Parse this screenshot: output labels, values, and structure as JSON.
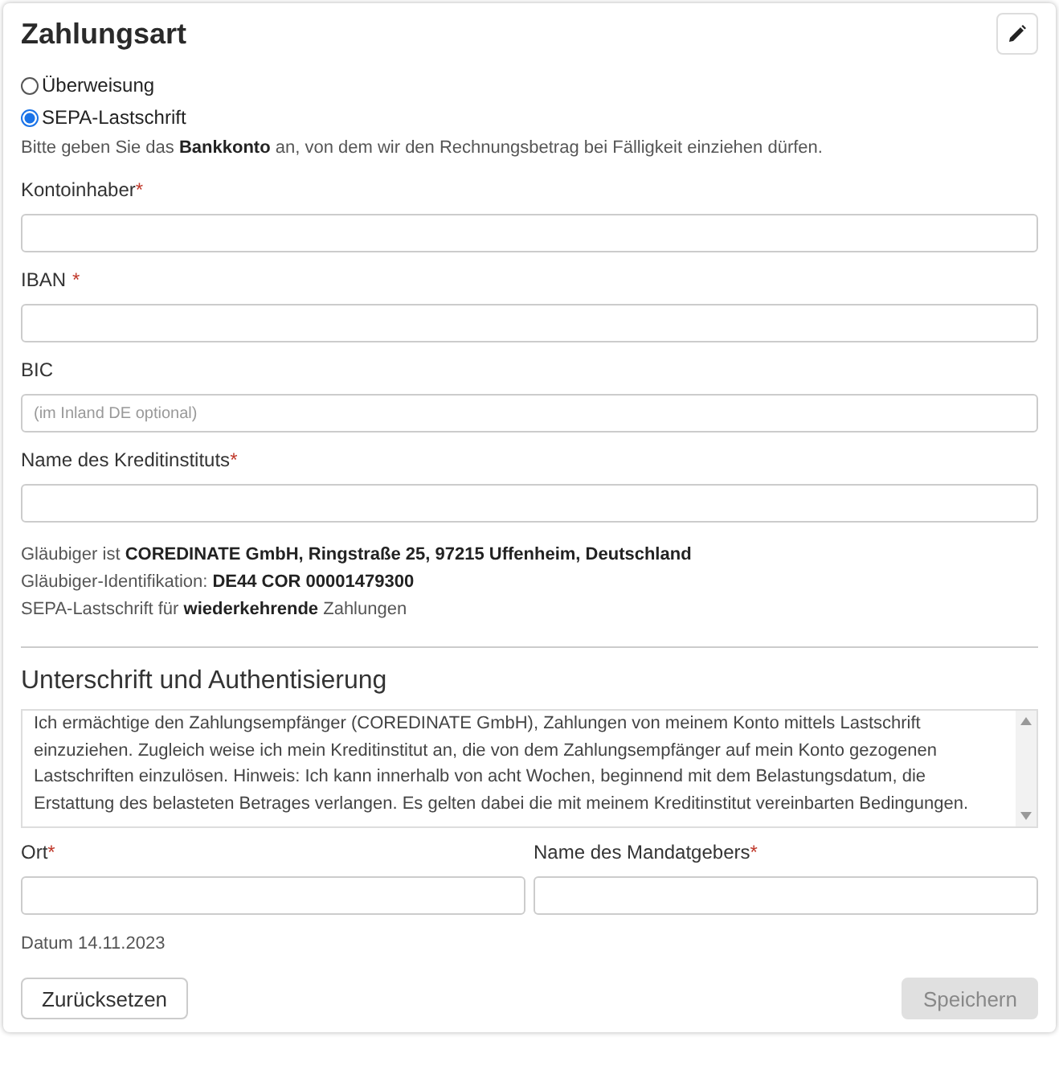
{
  "title": "Zahlungsart",
  "payment_options": [
    {
      "label": "Überweisung",
      "selected": false
    },
    {
      "label": "SEPA-Lastschrift",
      "selected": true
    }
  ],
  "hint": "Bitte geben Sie das **Bankkonto** an, von dem wir den Rechnungsbetrag bei Fälligkeit einziehen dürfen.",
  "fields": [
    {
      "label": "Kontoinhaber",
      "required_mark": "*"
    },
    {
      "label": "IBAN",
      "required_mark": "*"
    },
    {
      "label": "BIC",
      "placeholder": "(im Inland DE optional)"
    },
    {
      "label": "Name des Kreditinstituts",
      "required_mark": "*"
    }
  ],
  "creditor_info": [
    "Gläubiger ist **COREDINATE GmbH, Ringstraße 25, 97215 Uffenheim, Deutschland**",
    "Gläubiger-Identifikation: **DE44 COR 00001479300**",
    "SEPA-Lastschrift für **wiederkehrende** Zahlungen"
  ],
  "signature_heading": "Unterschrift und Authentisierung",
  "mandate_text": "Ich ermächtige den Zahlungsempfänger (COREDINATE GmbH), Zahlungen von meinem Konto mittels Lastschrift einzuziehen. Zugleich weise ich mein Kreditinstitut an, die von dem Zahlungsempfänger auf mein Konto gezogenen Lastschriften einzulösen. Hinweis: Ich kann innerhalb von acht Wochen, beginnend mit dem Belastungsdatum, die Erstattung des belasteten Betrages verlangen. Es gelten dabei die mit meinem Kreditinstitut vereinbarten Bedingungen.",
  "signature_fields": [
    {
      "label": "Ort",
      "required_mark": "*"
    },
    {
      "label": "Name des Mandatgebers",
      "required_mark": "*"
    }
  ],
  "date": "Datum 14.11.2023",
  "buttons": [
    {
      "label": "Zurücksetzen",
      "disabled": false
    },
    {
      "label": "Speichern",
      "disabled": true
    }
  ]
}
